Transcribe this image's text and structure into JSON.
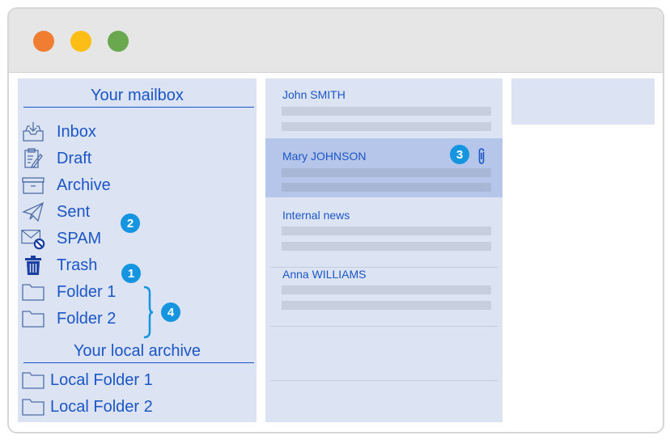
{
  "window": {
    "controls": [
      "close-dot",
      "minimize-dot",
      "maximize-dot"
    ],
    "colors": {
      "close": "#f07d32",
      "minimize": "#fcbd15",
      "maximize": "#6aa84f"
    }
  },
  "sidebar": {
    "mailbox_title": "Your mailbox",
    "items": [
      {
        "label": "Inbox",
        "icon": "inbox-icon"
      },
      {
        "label": "Draft",
        "icon": "draft-icon"
      },
      {
        "label": "Archive",
        "icon": "archive-box-icon"
      },
      {
        "label": "Sent",
        "icon": "paper-plane-icon",
        "badge": "2"
      },
      {
        "label": "SPAM",
        "icon": "spam-icon"
      },
      {
        "label": "Trash",
        "icon": "trash-icon",
        "badge": "1"
      },
      {
        "label": "Folder 1",
        "icon": "folder-icon"
      },
      {
        "label": "Folder 2",
        "icon": "folder-icon"
      }
    ],
    "folders_badge": "4",
    "local_title": "Your local archive",
    "local_items": [
      {
        "label": "Local Folder 1",
        "icon": "folder-icon"
      },
      {
        "label": "Local Folder 2",
        "icon": "folder-icon"
      }
    ]
  },
  "messages": [
    {
      "sender": "John SMITH",
      "selected": false
    },
    {
      "sender": "Mary JOHNSON",
      "selected": true,
      "badge": "3",
      "attachment": true
    },
    {
      "sender": "Internal news",
      "selected": false
    },
    {
      "sender": "Anna WILLIAMS",
      "selected": false
    }
  ],
  "theme": {
    "accent": "#1b56c6",
    "badge": "#1595e0",
    "panel": "#dce3f3",
    "selected": "#b5c6ea"
  }
}
